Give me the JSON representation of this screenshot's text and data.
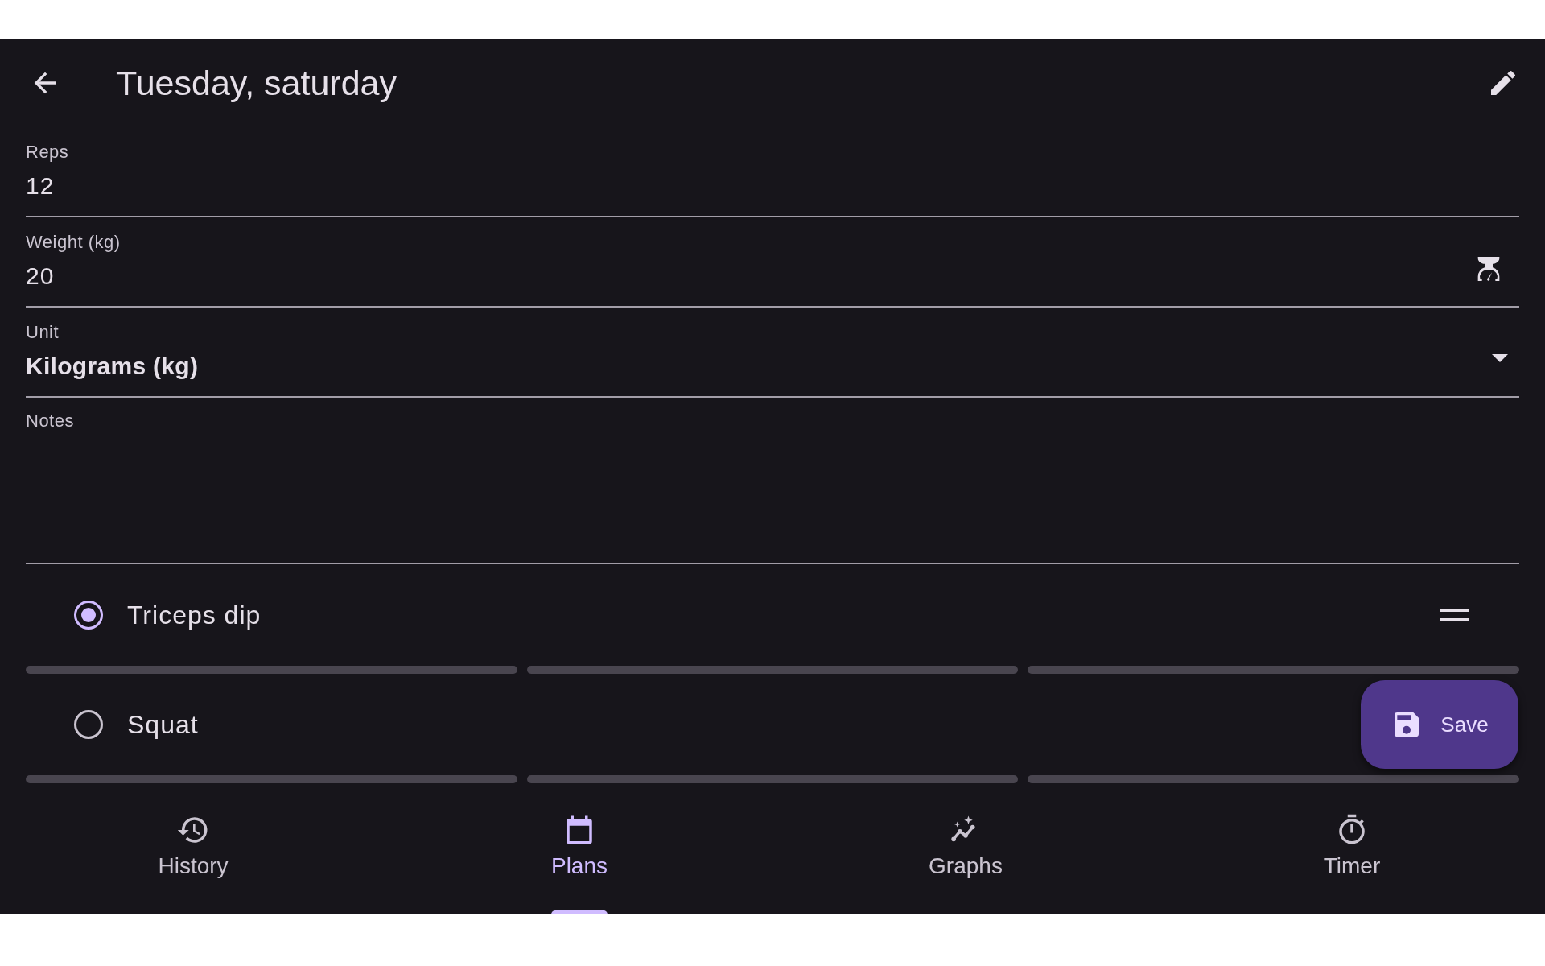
{
  "app_bar": {
    "title": "Tuesday, saturday"
  },
  "fields": [
    {
      "kind": "text",
      "label": "Reps",
      "value": "12"
    },
    {
      "kind": "scale",
      "label": "Weight (kg)",
      "value": "20"
    },
    {
      "kind": "dropdown",
      "label": "Unit",
      "value": "Kilograms (kg)"
    },
    {
      "kind": "multiline",
      "label": "Notes"
    }
  ],
  "exercises": [
    {
      "name": "Triceps dip",
      "selected": true,
      "drag_handle": true,
      "set_bars": [
        {
          "level": 0
        },
        {
          "level": 0
        },
        {
          "level": 0
        }
      ]
    },
    {
      "name": "Squat",
      "selected": false,
      "drag_handle": false,
      "set_bars": [
        {
          "level": 0
        },
        {
          "level": 0
        },
        {
          "level": 0
        }
      ]
    }
  ],
  "save_button": {
    "label": "Save"
  },
  "nav": [
    {
      "kind": "history",
      "label": "History",
      "selected": false
    },
    {
      "kind": "plans",
      "label": "Plans",
      "selected": true
    },
    {
      "kind": "graphs",
      "label": "Graphs",
      "selected": false
    },
    {
      "kind": "timer",
      "label": "Timer",
      "selected": false
    }
  ]
}
